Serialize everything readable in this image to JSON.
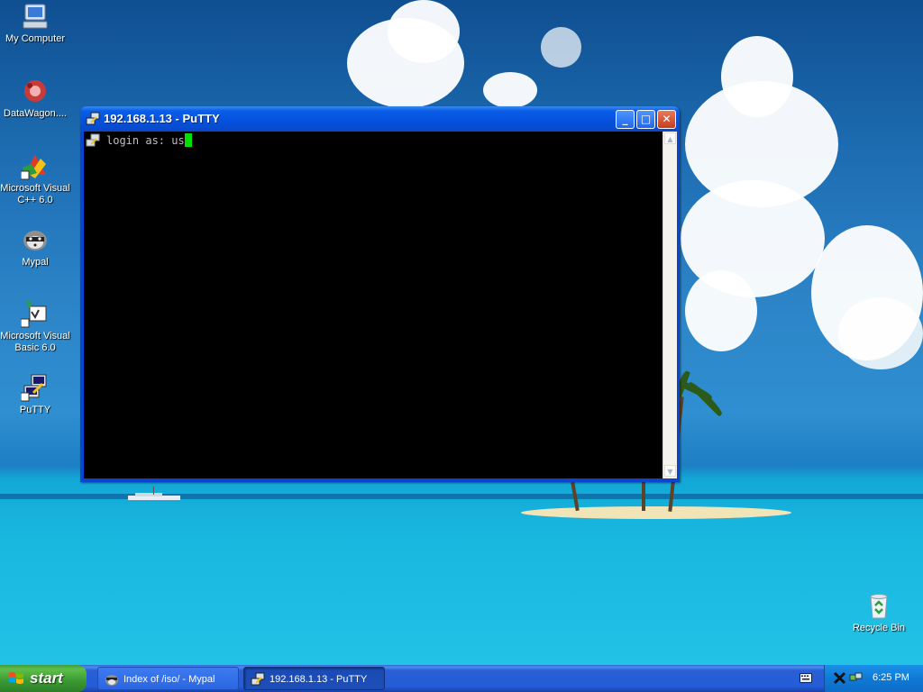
{
  "desktop": {
    "icons": [
      {
        "label": "My Computer",
        "icon": "my-computer-icon"
      },
      {
        "label": "DataWagon....",
        "icon": "datawagon-icon"
      },
      {
        "label": "Microsoft Visual C++ 6.0",
        "icon": "visual-cpp-icon"
      },
      {
        "label": "Mypal",
        "icon": "mypal-icon"
      },
      {
        "label": "Microsoft Visual Basic 6.0",
        "icon": "visual-basic-icon"
      },
      {
        "label": "PuTTY",
        "icon": "putty-icon"
      }
    ],
    "recycle_bin": {
      "label": "Recycle Bin",
      "icon": "recycle-bin-icon"
    }
  },
  "putty_window": {
    "title": "192.168.1.13 - PuTTY",
    "terminal_line": "login as: us",
    "buttons": {
      "minimize": "_",
      "maximize": "□",
      "close": "✕"
    }
  },
  "taskbar": {
    "start_label": "start",
    "tasks": [
      {
        "label": "Index of /iso/ - Mypal",
        "icon": "mypal-icon"
      },
      {
        "label": "192.168.1.13 - PuTTY",
        "icon": "putty-icon"
      }
    ],
    "clock": "6:25 PM"
  },
  "colors": {
    "title_bar": "#0551dd",
    "terminal_bg": "#000000",
    "cursor": "#00e000",
    "start_button": "#3a9a32"
  }
}
